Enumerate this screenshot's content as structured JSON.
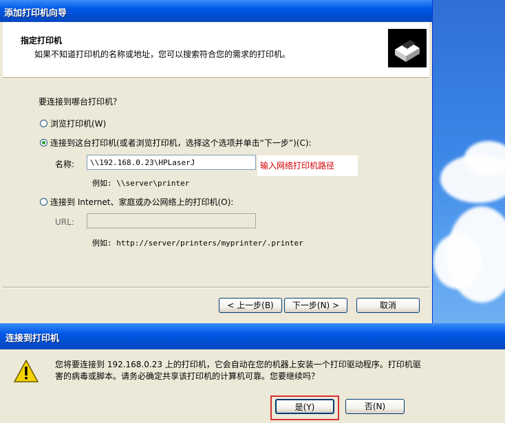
{
  "wizard": {
    "title": "添加打印机向导",
    "header_title": "指定打印机",
    "header_subtitle": "如果不知道打印机的名称或地址，您可以搜索符合您的需求的打印机。",
    "question": "要连接到哪台打印机？",
    "option_browse": "浏览打印机(W)",
    "option_connect": "连接到这台打印机(或者浏览打印机，选择这个选项并单击“下一步”)(C):",
    "name_label": "名称:",
    "name_value": "\\\\192.168.0.23\\HPLaserJ",
    "annotation": "输入网络打印机路径",
    "name_example": "例如: \\\\server\\printer",
    "option_internet": "连接到 Internet、家庭或办公网络上的打印机(O):",
    "url_label": "URL:",
    "url_value": "",
    "url_example": "例如: http://server/printers/myprinter/.printer",
    "buttons": {
      "back": "< 上一步(B)",
      "next": "下一步(N) >",
      "cancel": "取消"
    }
  },
  "dialog": {
    "title": "连接到打印机",
    "message_line1": "您将要连接到 192.168.0.23 上的打印机，它会自动在您的机器上安装一个打印驱动程序。打印机驱",
    "message_line2": "害的病毒或脚本。请务必确定共享该打印机的计算机可靠。您要继续吗？",
    "buttons": {
      "yes": "是(Y)",
      "no": "否(N)"
    }
  },
  "colors": {
    "titlebar": "#0058e6",
    "annotation_text": "#d40000",
    "highlight_box": "#d83030"
  }
}
